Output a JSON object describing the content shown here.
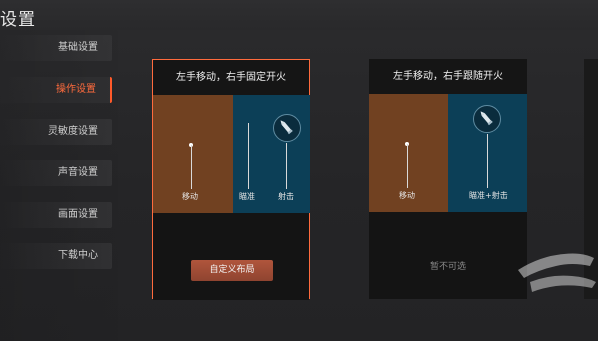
{
  "header": {
    "title": "设置"
  },
  "sidebar": {
    "items": [
      {
        "label": "基础设置",
        "active": false
      },
      {
        "label": "操作设置",
        "active": true
      },
      {
        "label": "灵敏度设置",
        "active": false
      },
      {
        "label": "声音设置",
        "active": false
      },
      {
        "label": "画面设置",
        "active": false
      },
      {
        "label": "下载中心",
        "active": false
      }
    ]
  },
  "cards": [
    {
      "title": "左手移动，右手固定开火",
      "move_label": "移动",
      "aim_label": "瞄准",
      "fire_label": "射击",
      "button_label": "自定义布局"
    },
    {
      "title": "左手移动，右手跟随开火",
      "move_label": "移动",
      "aim_fire_label": "瞄准+射击",
      "status_label": "暂不可选"
    }
  ],
  "colors": {
    "accent": "#ff6b3d",
    "move_zone": "#714121",
    "fire_zone": "#0c3f57",
    "button": "#a14c36"
  }
}
